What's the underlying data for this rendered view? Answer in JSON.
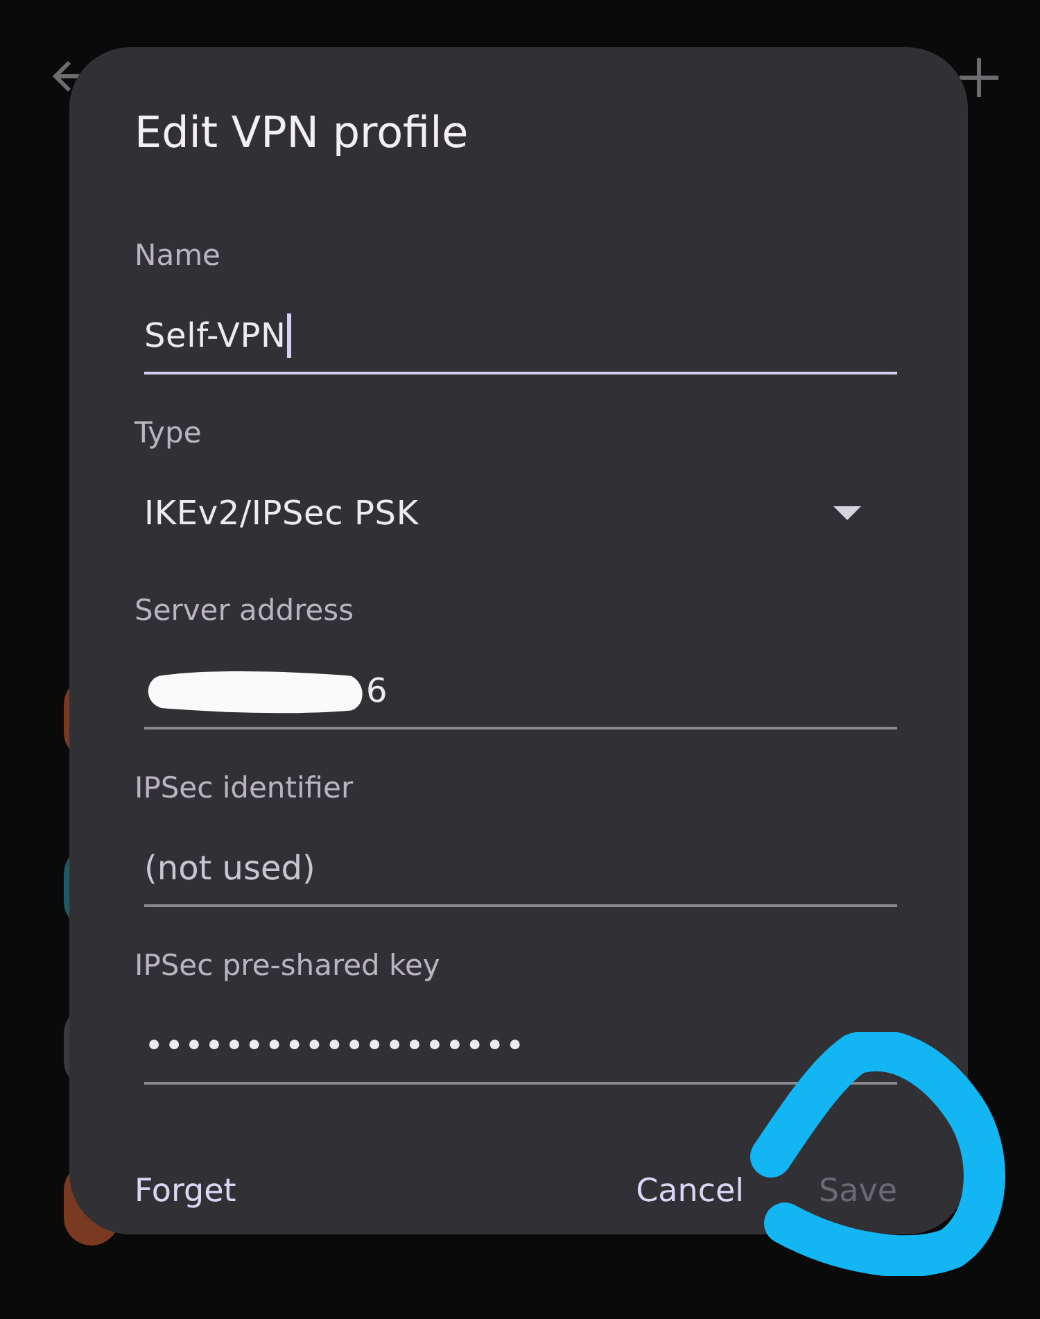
{
  "dialog": {
    "title": "Edit VPN profile",
    "fields": [
      {
        "label": "Name",
        "kind": "text",
        "value": "Self-VPN",
        "focused": true
      },
      {
        "label": "Type",
        "kind": "dropdown",
        "value": "IKEv2/IPSec PSK"
      },
      {
        "label": "Server address",
        "kind": "text",
        "value": "6",
        "focused": false,
        "redacted": true
      },
      {
        "label": "IPSec identifier",
        "kind": "text",
        "placeholder": "(not used)",
        "focused": false
      },
      {
        "label": "IPSec pre-shared key",
        "kind": "text",
        "value": "•••••••••••••••••••",
        "focused": false
      }
    ],
    "buttons": [
      {
        "label": "Forget",
        "disabled": false
      },
      {
        "label": "Cancel",
        "disabled": false
      },
      {
        "label": "Save",
        "disabled": true
      }
    ]
  }
}
